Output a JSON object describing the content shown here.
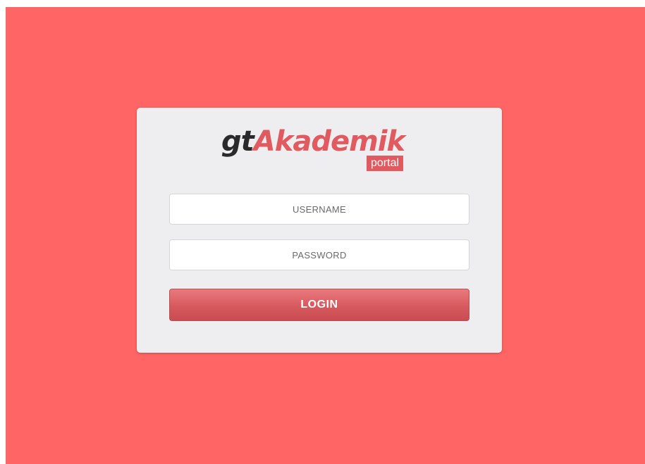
{
  "logo": {
    "prefix": "gt",
    "name": "Akademik",
    "badge": "portal"
  },
  "form": {
    "username_placeholder": "USERNAME",
    "username_value": "",
    "password_placeholder": "PASSWORD",
    "password_value": "",
    "login_label": "LOGIN"
  },
  "colors": {
    "page_background": "#ff6565",
    "card_background": "#eeeef0",
    "brand_accent": "#e05a5f",
    "logo_dark": "#2a2a2a",
    "button_gradient": [
      "#e97a7e",
      "#c84c51"
    ]
  }
}
